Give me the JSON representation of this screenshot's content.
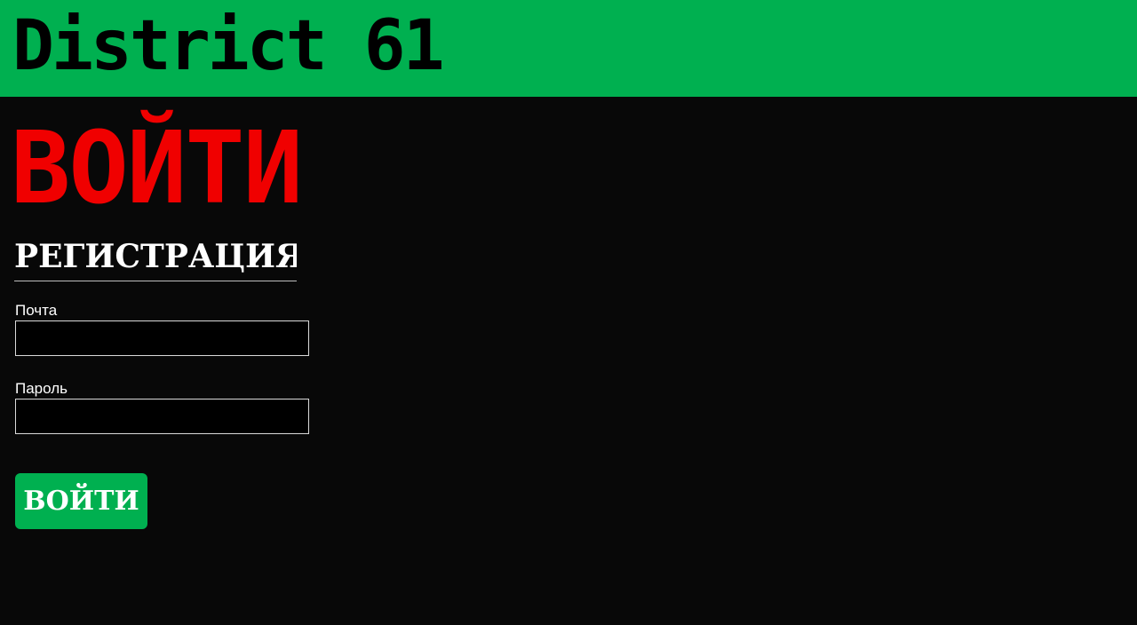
{
  "header": {
    "brand": "District 61"
  },
  "login": {
    "title": "ВОЙТИ",
    "register_tab": "РЕГИСТРАЦИЯ",
    "email_label": "Почта",
    "email_value": "",
    "password_label": "Пароль",
    "password_value": "",
    "submit_label": "ВОЙТИ"
  },
  "colors": {
    "header_bg": "#00b050",
    "page_bg": "#080808",
    "title": "#f00000",
    "button_bg": "#00b050"
  }
}
